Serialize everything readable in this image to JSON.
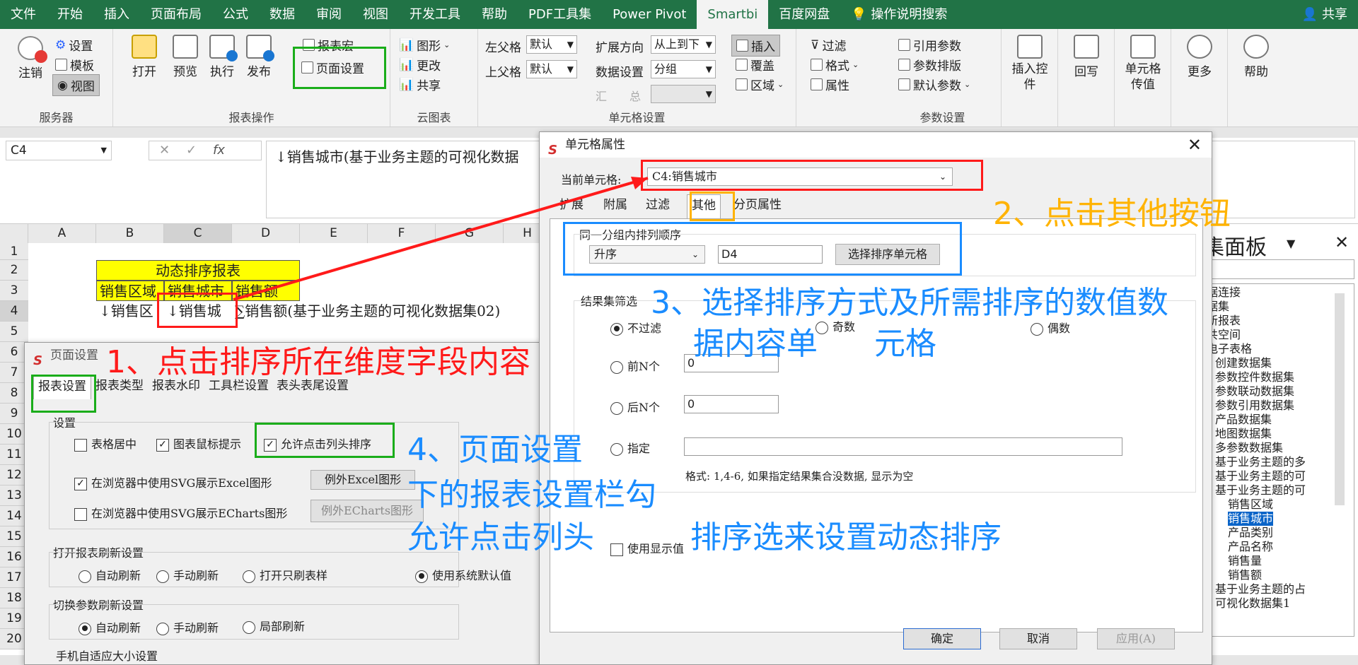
{
  "tabs": [
    "文件",
    "开始",
    "插入",
    "页面布局",
    "公式",
    "数据",
    "审阅",
    "视图",
    "开发工具",
    "帮助",
    "PDF工具集",
    "Power Pivot",
    "Smartbi",
    "百度网盘"
  ],
  "active_tab": "Smartbi",
  "tell_me": "操作说明搜索",
  "share": "共享",
  "ribbon": {
    "server": {
      "label": "服务器",
      "logout": "注销",
      "settings": "设置",
      "template": "模板",
      "view": "视图"
    },
    "report_ops": {
      "label": "报表操作",
      "open": "打开",
      "preview": "预览",
      "execute": "执行",
      "publish": "发布",
      "macro": "报表宏",
      "page_setup": "页面设置"
    },
    "cloud_chart": {
      "label": "云图表",
      "chart": "图形",
      "change": "更改",
      "share": "共享"
    },
    "cell_settings": {
      "label": "单元格设置",
      "left_parent": "左父格",
      "top_parent": "上父格",
      "default1": "默认",
      "default2": "默认",
      "expand_dir": "扩展方向",
      "expand_val": "从上到下",
      "data_setting": "数据设置",
      "data_val": "分组",
      "summary": "汇",
      "total": "总",
      "insert": "插入",
      "cover": "覆盖",
      "region": "区域"
    },
    "filter_grp": {
      "filter": "过滤",
      "format": "格式",
      "attr": "属性"
    },
    "param_settings": {
      "label": "参数设置",
      "ref": "引用参数",
      "layout": "参数排版",
      "default": "默认参数"
    },
    "insert_ctrl": "插入控件",
    "writeback": "回写",
    "cell_value": "单元格传值",
    "more": "更多",
    "help": "帮助"
  },
  "formula": {
    "namebox": "C4",
    "fx": "fx",
    "content": "↓销售城市(基于业务主题的可视化数据"
  },
  "sheet": {
    "cols": [
      "A",
      "B",
      "C",
      "D",
      "E",
      "F",
      "G",
      "H"
    ],
    "rows": [
      "1",
      "2",
      "3",
      "4",
      "5",
      "6",
      "7",
      "8",
      "9",
      "10",
      "11",
      "12",
      "13",
      "14",
      "15",
      "16",
      "17",
      "18",
      "19",
      "20"
    ],
    "title": "动态排序报表",
    "h1": "销售区域",
    "h2": "销售城市",
    "h3": "销售额",
    "r4b": "↓销售区",
    "r4c": "↓销售城",
    "r4d": "∑销售额(基于业务主题的可视化数据集02)"
  },
  "page_dialog": {
    "title": "页面设置",
    "tabs": [
      "报表设置",
      "报表类型",
      "报表水印",
      "工具栏设置",
      "表头表尾设置"
    ],
    "sec_settings": "设置",
    "center": "表格居中",
    "hover": "图表鼠标提示",
    "allow_sort": "允许点击列头排序",
    "svg_excel": "在浏览器中使用SVG展示Excel图形",
    "exc_excel": "例外Excel图形",
    "svg_echarts": "在浏览器中使用SVG展示ECharts图形",
    "exc_echarts": "例外ECharts图形",
    "sec_refresh": "打开报表刷新设置",
    "auto": "自动刷新",
    "manual": "手动刷新",
    "open_only": "打开只刷表样",
    "sys_default": "使用系统默认值",
    "sec_switch": "切换参数刷新设置",
    "auto2": "自动刷新",
    "manual2": "手动刷新",
    "partial": "局部刷新",
    "sec_mobile": "手机自适应大小设置"
  },
  "cell_dialog": {
    "title": "单元格属性",
    "current_label": "当前单元格:",
    "current_value": "C4:销售城市",
    "tabs": [
      "扩展",
      "附属",
      "过滤",
      "其他",
      "分页属性"
    ],
    "group_title": "同一分组内排列顺序",
    "order": "升序",
    "order_cell": "D4",
    "select_btn": "选择排序单元格",
    "filter_title": "结果集筛选",
    "no_filter": "不过滤",
    "odd": "奇数",
    "even": "偶数",
    "top_n": "前N个",
    "top_n_val": "0",
    "bottom_n": "后N个",
    "bottom_n_val": "0",
    "specify": "指定",
    "format_hint": "格式: 1,4-6, 如果指定结果集合没数据, 显示为空",
    "use_display": "使用显示值",
    "ok": "确定",
    "cancel": "取消",
    "apply": "应用(A)"
  },
  "panel": {
    "title": "集面板",
    "items": [
      "据连接",
      "据集",
      "新报表",
      "共空间",
      "电子表格",
      "创建数据集",
      "参数控件数据集",
      "参数联动数据集",
      "参数引用数据集",
      "产品数据集",
      "地图数据集",
      "多参数数据集",
      "基于业务主题的多",
      "基于业务主题的可",
      "基于业务主题的可",
      "销售区域",
      "销售城市",
      "产品类别",
      "产品名称",
      "销售量",
      "销售额",
      "基于业务主题的占",
      "可视化数据集1"
    ]
  },
  "annotations": {
    "a1": "1、点击排序所在维度字段内容",
    "a2": "2、点击其他按钮",
    "a3a": "3、选择排序方式及所需排序的数值数",
    "a3b": "据内容单",
    "a3c": "元格",
    "a4a": "4、页面设置",
    "a4b": "下的报表设置栏勾",
    "a4c": "允许点击列头",
    "a4d": "排序选来设置动态排序"
  },
  "colors": {
    "excel_green": "#217346",
    "red": "#ff1a1a",
    "blue": "#1a8cff",
    "orange": "#ffb300",
    "green": "#1aad1a"
  }
}
